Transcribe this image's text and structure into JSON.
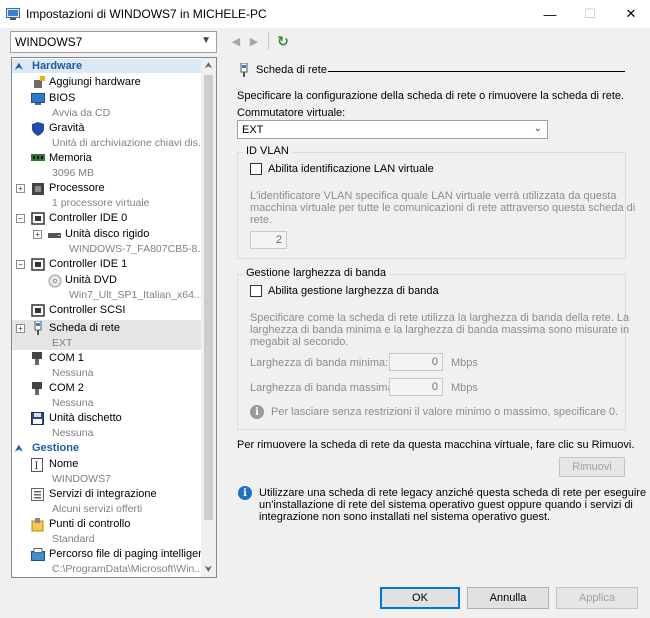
{
  "window": {
    "title": "Impostazioni di WINDOWS7 in MICHELE-PC",
    "controls": {
      "minimize": "—",
      "maximize": "☐",
      "close": "✕"
    }
  },
  "toolbar": {
    "vm_selected": "WINDOWS7",
    "back_icon": "◀",
    "forward_icon": "▶",
    "refresh_icon": "↻"
  },
  "tree": {
    "sections": [
      {
        "label": "Hardware",
        "icon": "chevron-up-icon"
      },
      {
        "label": "Gestione",
        "icon": "chevron-up-icon"
      }
    ],
    "items": [
      {
        "label": "Aggiungi hardware",
        "sub": "",
        "icon": "add-hardware-icon"
      },
      {
        "label": "BIOS",
        "sub": "Avvia da CD",
        "icon": "bios-icon"
      },
      {
        "label": "Gravità",
        "sub": "Unità di archiviazione chiavi dis...",
        "icon": "shield-icon"
      },
      {
        "label": "Memoria",
        "sub": "3096 MB",
        "icon": "memory-icon"
      },
      {
        "label": "Processore",
        "sub": "1 processore virtuale",
        "icon": "processor-icon",
        "expander": "+"
      },
      {
        "label": "Controller IDE 0",
        "sub": "",
        "icon": "ide-controller-icon",
        "expander": "−"
      },
      {
        "label": "Unità disco rigido",
        "sub": "WINDOWS-7_FA807CB5-8...",
        "icon": "hard-disk-icon",
        "expander": "+"
      },
      {
        "label": "Controller IDE 1",
        "sub": "",
        "icon": "ide-controller-icon",
        "expander": "−"
      },
      {
        "label": "Unità DVD",
        "sub": "Win7_Ult_SP1_Italian_x64....",
        "icon": "dvd-icon"
      },
      {
        "label": "Controller SCSI",
        "sub": "",
        "icon": "scsi-controller-icon"
      },
      {
        "label": "Scheda di rete",
        "sub": "EXT",
        "icon": "network-adapter-icon",
        "expander": "+"
      },
      {
        "label": "COM 1",
        "sub": "Nessuna",
        "icon": "com-port-icon"
      },
      {
        "label": "COM 2",
        "sub": "Nessuna",
        "icon": "com-port-icon"
      },
      {
        "label": "Unità dischetto",
        "sub": "Nessuna",
        "icon": "floppy-icon"
      },
      {
        "label": "Nome",
        "sub": "WINDOWS7",
        "icon": "name-icon"
      },
      {
        "label": "Servizi di integrazione",
        "sub": "Alcuni servizi offerti",
        "icon": "integration-services-icon"
      },
      {
        "label": "Punti di controllo",
        "sub": "Standard",
        "icon": "checkpoint-icon"
      },
      {
        "label": "Percorso file di paging intelligente",
        "sub": "C:\\ProgramData\\Microsoft\\Win...",
        "icon": "paging-file-icon"
      }
    ]
  },
  "panel": {
    "title": "Scheda di rete",
    "description": "Specificare la configurazione della scheda di rete o rimuovere la scheda di rete.",
    "switch_label": "Commutatore virtuale:",
    "switch_value": "EXT",
    "vlan": {
      "group_label": "ID VLAN",
      "checkbox_label": "Abilita identificazione LAN virtuale",
      "help": [
        "L'identificatore VLAN specifica quale LAN virtuale verrà utilizzata da questa",
        "macchina virtuale per tutte le comunicazioni di rete attraverso questa scheda di",
        "rete."
      ],
      "value": "2"
    },
    "bandwidth": {
      "group_label": "Gestione larghezza di banda",
      "checkbox_label": "Abilita gestione larghezza di banda",
      "help": [
        "Specificare come la scheda di rete utilizza la larghezza di banda della rete. La",
        "larghezza di banda minima e la larghezza di banda massima sono misurate in",
        "megabit al secondo."
      ],
      "min_label": "Larghezza di banda minima:",
      "min_value": "0",
      "max_label": "Larghezza di banda massima:",
      "max_value": "0",
      "unit": "Mbps",
      "note": "Per lasciare senza restrizioni il valore minimo o massimo, specificare 0."
    },
    "remove_text": "Per rimuovere la scheda di rete da questa macchina virtuale, fare clic su Rimuovi.",
    "remove_button": "Rimuovi",
    "legacy_info": [
      "Utilizzare una scheda di rete legacy anziché questa scheda di rete per eseguire",
      "un'installazione di rete del sistema operativo guest oppure quando i servizi di",
      "integrazione non sono installati nel sistema operativo guest."
    ]
  },
  "buttons": {
    "ok": "OK",
    "cancel": "Annulla",
    "apply": "Applica"
  },
  "colors": {
    "accent": "#0078d7",
    "section": "#1e5aa8",
    "info": "#1e6fc8"
  }
}
